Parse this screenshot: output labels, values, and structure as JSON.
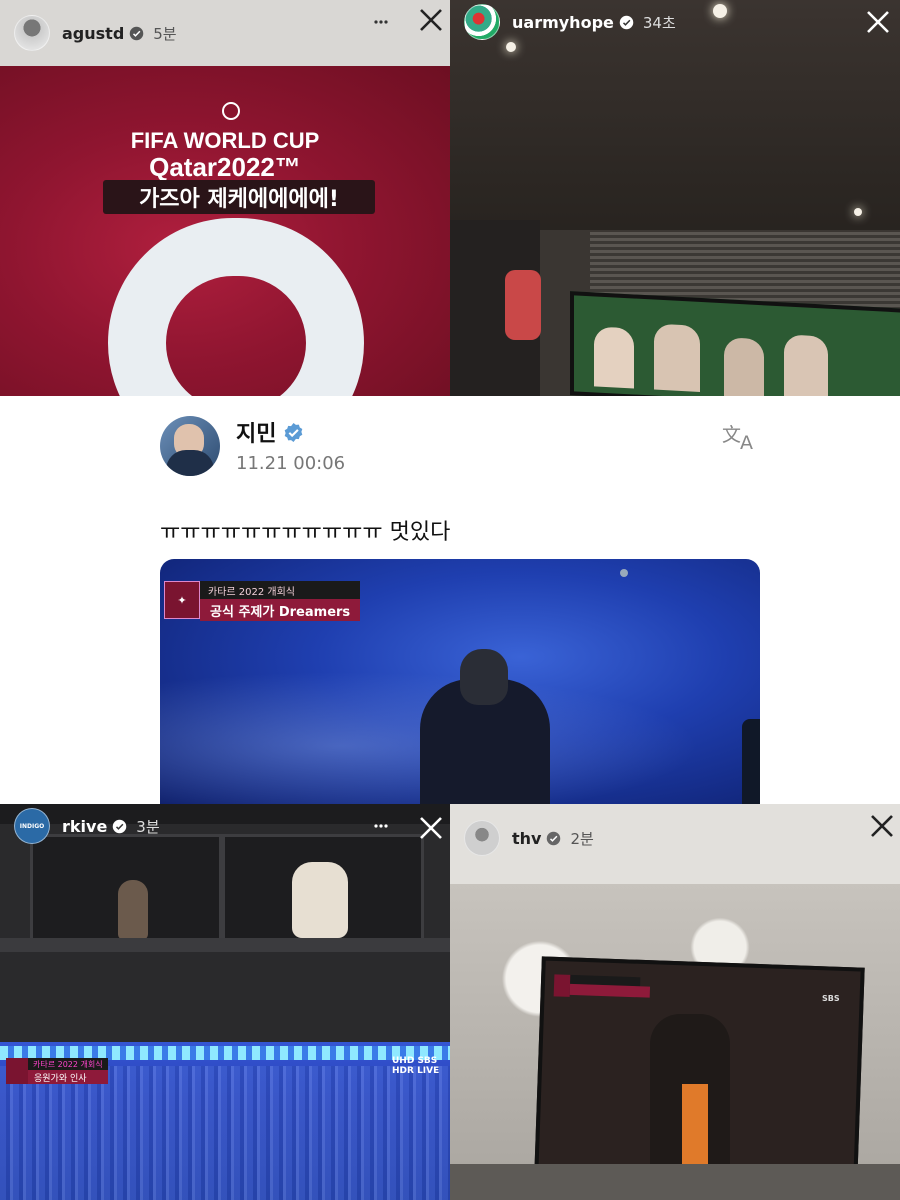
{
  "stories": {
    "top_left": {
      "username": "agustd",
      "time": "5분",
      "tv": {
        "logo_line1": "FIFA WORLD CUP",
        "logo_line2": "Qatar2022™",
        "caption": "가즈아 제케에에에에!"
      }
    },
    "top_right": {
      "username": "uarmyhope",
      "time": "34초"
    },
    "bottom_left": {
      "username": "rkive",
      "time": "3분",
      "avatar_text": "INDIGO",
      "tv": {
        "banner_top": "카타르 2022 개회식",
        "banner_bottom": "응원가와 인사",
        "channel": "UHD SBS HDR LIVE"
      }
    },
    "bottom_right": {
      "username": "thv",
      "time": "2분",
      "tv": {
        "channel": "SBS"
      }
    }
  },
  "tweet": {
    "name": "지민",
    "timestamp": "11.21 00:06",
    "text": "ㅠㅠㅠㅠㅠㅠㅠㅠㅠㅠㅠ 멋있다",
    "media": {
      "banner_top": "카타르 2022 개회식",
      "banner_bottom": "공식 주제가 Dreamers"
    }
  },
  "colors": {
    "verified": "#3897f0",
    "tweet_verified": "#5b9bd5",
    "qatar_maroon": "#8e1a3a"
  },
  "icons": [
    "verified-badge-icon",
    "close-icon",
    "translate-icon"
  ]
}
